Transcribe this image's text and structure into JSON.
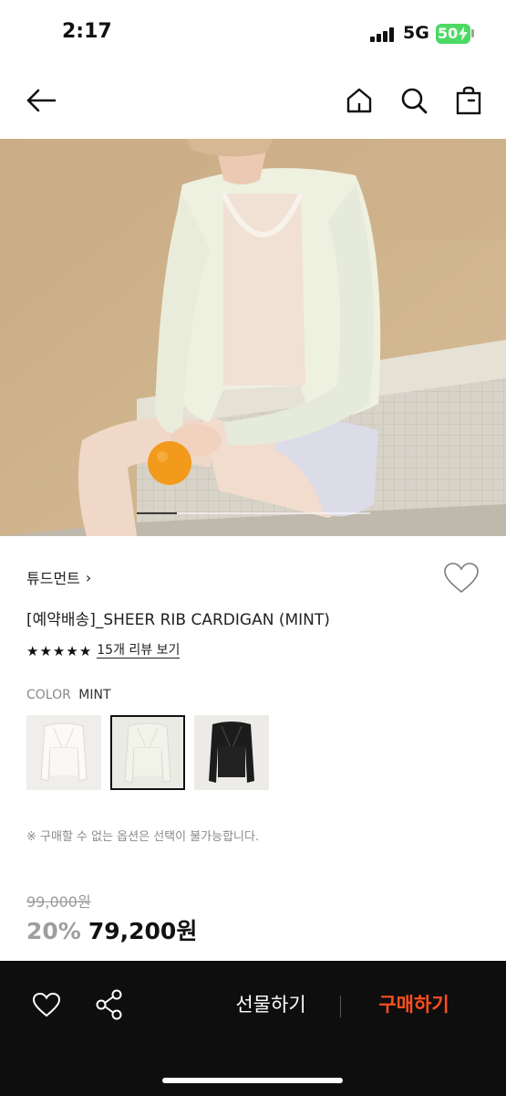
{
  "status": {
    "time": "2:17",
    "network": "5G",
    "battery": "50"
  },
  "header": {
    "icons": [
      "back-arrow-icon",
      "home-icon",
      "search-icon",
      "shopping-bag-icon"
    ]
  },
  "hero": {
    "carousel_progress": 0.17
  },
  "product": {
    "brand": "튜드먼트",
    "brand_chevron": "›",
    "title": "[예약배송]_SHEER RIB CARDIGAN (MINT)",
    "rating_stars": 5,
    "review_link": "15개 리뷰 보기",
    "color_label": "COLOR",
    "color_value": "MINT",
    "swatches": [
      {
        "name": "ivory",
        "color": "#f7f6f2"
      },
      {
        "name": "mint",
        "color": "#eef0e6"
      },
      {
        "name": "black",
        "color": "#1c1c1c"
      }
    ],
    "selected_swatch": 1,
    "notice": "※ 구매할 수 없는 옵션은 선택이 불가능합니다.",
    "original_price": "99,000원",
    "discount": "20%",
    "sale_price": "79,200원"
  },
  "bottom_bar": {
    "gift_label": "선물하기",
    "buy_label": "구매하기",
    "buy_color": "#ff4f1f"
  }
}
